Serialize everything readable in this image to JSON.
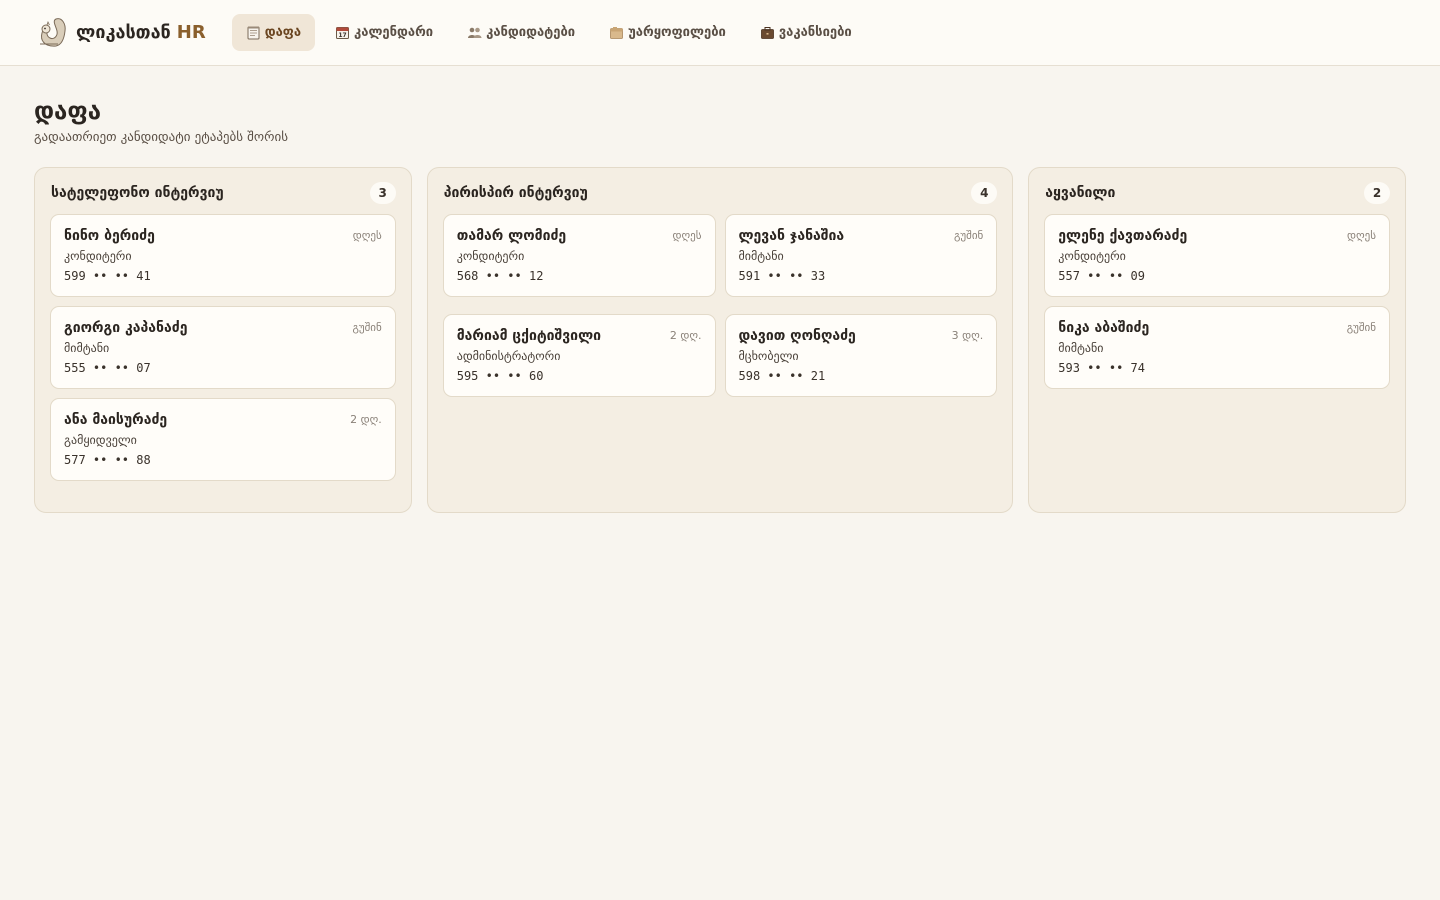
{
  "brand": {
    "name": "ლიკასთან",
    "suffix": "HR"
  },
  "nav": [
    {
      "label": "დაფა",
      "icon": "notepad-icon",
      "active": true
    },
    {
      "label": "კალენდარი",
      "icon": "calendar-icon",
      "active": false
    },
    {
      "label": "კანდიდატები",
      "icon": "people-icon",
      "active": false
    },
    {
      "label": "უარყოფილები",
      "icon": "archive-box-icon",
      "active": false
    },
    {
      "label": "ვაკანსიები",
      "icon": "briefcase-icon",
      "active": false
    }
  ],
  "page": {
    "title": "დაფა",
    "subtitle": "გადაათრიეთ კანდიდატი ეტაპებს შორის"
  },
  "columns": [
    {
      "title": "სატელეფონო ინტერვიუ",
      "count": "3",
      "cards": [
        {
          "name": "ნინო ბერიძე",
          "time": "დღეს",
          "role": "კონდიტერი",
          "phone": "599 •• •• 41"
        },
        {
          "name": "გიორგი კაპანაძე",
          "time": "გუშინ",
          "role": "მიმტანი",
          "phone": "555 •• •• 07"
        },
        {
          "name": "ანა მაისურაძე",
          "time": "2 დღ.",
          "role": "გამყიდველი",
          "phone": "577 •• •• 88"
        }
      ]
    },
    {
      "title": "პირისპირ ინტერვიუ",
      "count": "4",
      "cards": [
        {
          "name": "თამარ ლომიძე",
          "time": "დღეს",
          "role": "კონდიტერი",
          "phone": "568 •• •• 12"
        },
        {
          "name": "ლევან ჯანაშია",
          "time": "გუშინ",
          "role": "მიმტანი",
          "phone": "591 •• •• 33"
        },
        {
          "name": "მარიამ ცქიტიშვილი",
          "time": "2 დღ.",
          "role": "ადმინისტრატორი",
          "phone": "595 •• •• 60"
        },
        {
          "name": "დავით ღონღაძე",
          "time": "3 დღ.",
          "role": "მცხობელი",
          "phone": "598 •• •• 21"
        }
      ]
    },
    {
      "title": "აყვანილი",
      "count": "2",
      "cards": [
        {
          "name": "ელენე ქავთარაძე",
          "time": "დღეს",
          "role": "კონდიტერი",
          "phone": "557 •• •• 09"
        },
        {
          "name": "ნიკა აბაშიძე",
          "time": "გუშინ",
          "role": "მიმტანი",
          "phone": "593 •• •• 74"
        }
      ]
    }
  ],
  "colors": {
    "accent": "#8a5f2c",
    "background": "#f8f5ef",
    "column_bg": "#f4eee3",
    "card_bg": "#fffdf9"
  }
}
